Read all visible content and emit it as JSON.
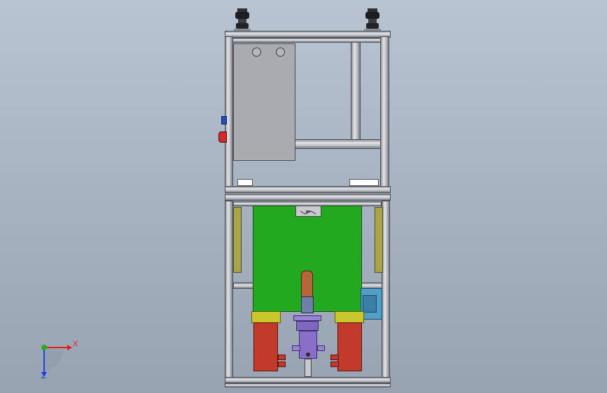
{
  "viewport": {
    "background_top": "#b9c4d3",
    "background_bottom": "#98a3b2"
  },
  "triad": {
    "x_label": "X",
    "z_label": "Z",
    "x_color": "#e02020",
    "y_color": "#20b020",
    "z_color": "#2040e0"
  },
  "model": {
    "frame_color": "#bcbfc4",
    "fixture_color": "#22a91f",
    "cylinder_color": "#c23a2a",
    "motor_color": "#8a6fc8",
    "bracket_color": "#c9c72c",
    "sensor_color": "#4f9fc9"
  }
}
